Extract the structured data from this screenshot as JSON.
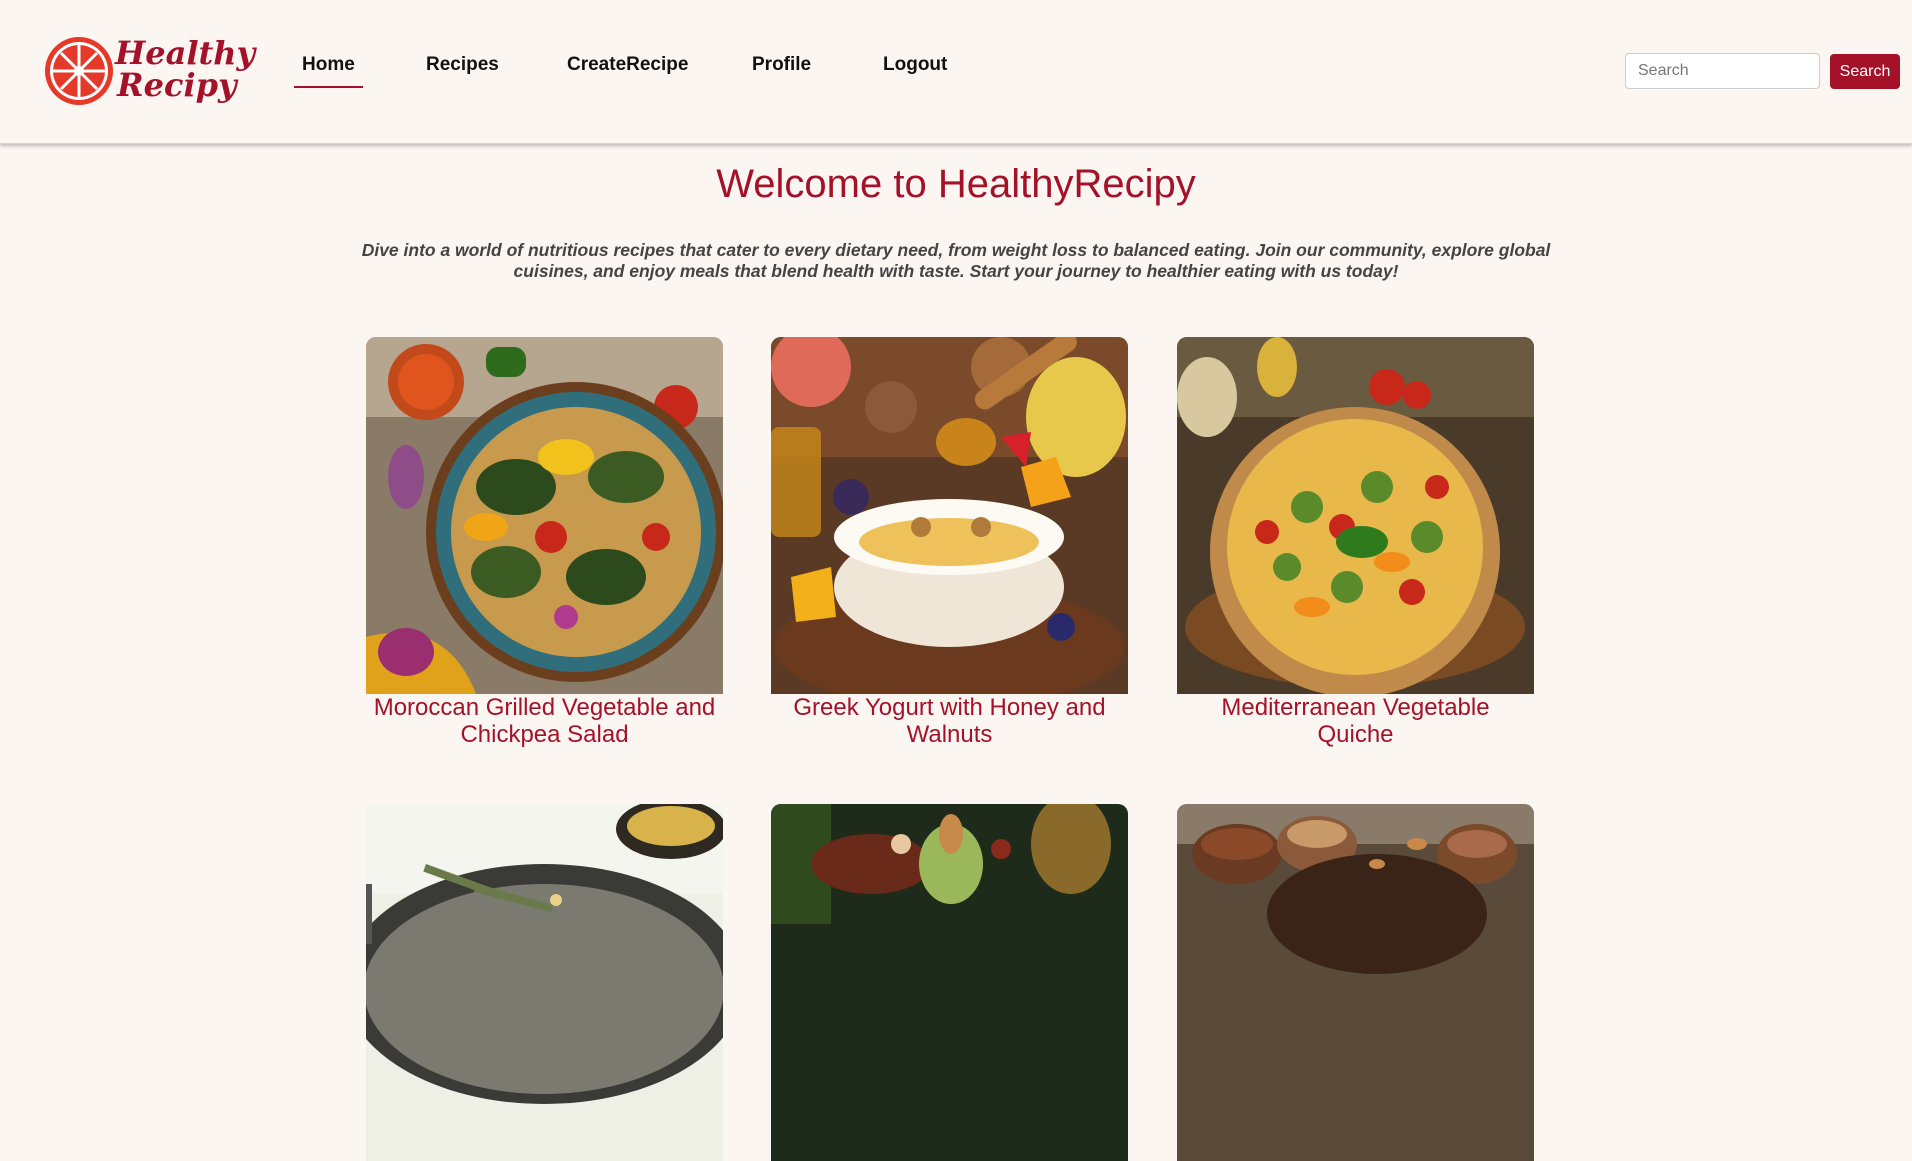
{
  "logo": {
    "line1": "Healthy",
    "line2": "Recipy"
  },
  "nav": {
    "items": [
      {
        "label": "Home"
      },
      {
        "label": "Recipes"
      },
      {
        "label": "CreateRecipe"
      },
      {
        "label": "Profile"
      },
      {
        "label": "Logout"
      }
    ],
    "active": "Home"
  },
  "search": {
    "placeholder": "Search",
    "button_label": "Search"
  },
  "hero": {
    "title": "Welcome to HealthyRecipy",
    "description": "Dive into a world of nutritious recipes that cater to every dietary need, from weight loss to balanced eating. Join our community, explore global cuisines, and enjoy meals that blend health with taste. Start your journey to healthier eating with us today!"
  },
  "recipes": [
    {
      "title": "Moroccan Grilled Vegetable and Chickpea Salad"
    },
    {
      "title": "Greek Yogurt with Honey and Walnuts"
    },
    {
      "title": "Mediterranean Vegetable Quiche"
    },
    {
      "title": ""
    },
    {
      "title": ""
    },
    {
      "title": ""
    }
  ],
  "colors": {
    "accent": "#a4122a",
    "background": "#fcf6f3"
  }
}
